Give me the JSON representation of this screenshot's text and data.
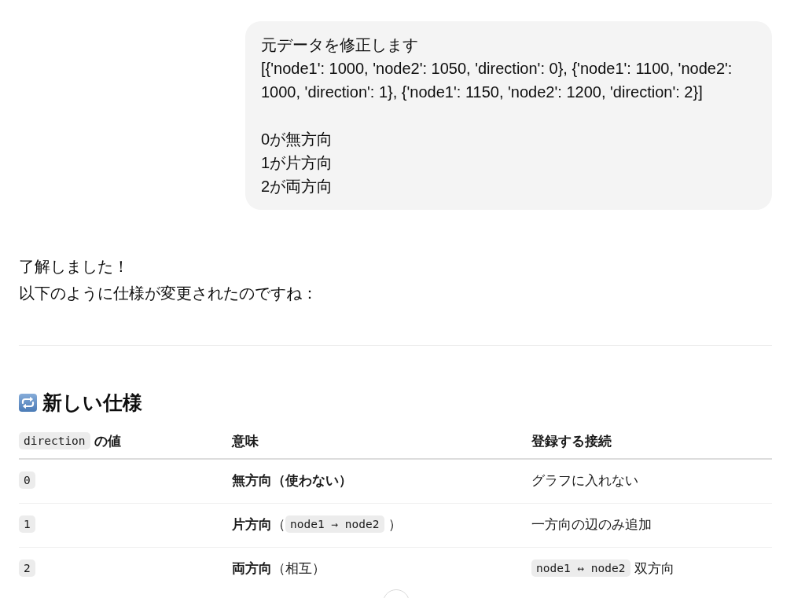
{
  "user_message": {
    "paragraphs": [
      {
        "lines": [
          "元データを修正します",
          "[{'node1': 1000, 'node2': 1050, 'direction': 0}, {'node1': 1100, 'node2': 1000, 'direction': 1}, {'node1': 1150, 'node2': 1200, 'direction': 2}]"
        ]
      },
      {
        "lines": [
          "0が無方向",
          "1が片方向",
          "2が両方向"
        ]
      }
    ]
  },
  "assistant_message": {
    "lines": [
      "了解しました！",
      "以下のように仕様が変更されたのですね："
    ],
    "section": {
      "heading": "新しい仕様",
      "table": {
        "columns": [
          {
            "segments": [
              {
                "kind": "code",
                "text": "direction"
              },
              {
                "kind": "text",
                "text": "の値"
              }
            ]
          },
          {
            "segments": [
              {
                "kind": "text",
                "text": "意味"
              }
            ]
          },
          {
            "segments": [
              {
                "kind": "text",
                "text": "登録する接続"
              }
            ]
          }
        ],
        "rows": [
          {
            "cells": [
              {
                "segments": [
                  {
                    "kind": "code",
                    "text": "0"
                  }
                ]
              },
              {
                "segments": [
                  {
                    "kind": "strong",
                    "text": "無方向（使わない）"
                  }
                ]
              },
              {
                "segments": [
                  {
                    "kind": "text",
                    "text": "グラフに入れない"
                  }
                ]
              }
            ]
          },
          {
            "cells": [
              {
                "segments": [
                  {
                    "kind": "code",
                    "text": "1"
                  }
                ]
              },
              {
                "segments": [
                  {
                    "kind": "text",
                    "text": "**片方向**（"
                  },
                  {
                    "kind": "code",
                    "text": "node1 → node2"
                  },
                  {
                    "kind": "text",
                    "text": "）"
                  }
                ]
              },
              {
                "segments": [
                  {
                    "kind": "text",
                    "text": "一方向の辺のみ追加"
                  }
                ]
              }
            ]
          },
          {
            "cells": [
              {
                "segments": [
                  {
                    "kind": "code",
                    "text": "2"
                  }
                ]
              },
              {
                "segments": [
                  {
                    "kind": "text",
                    "text": "**両方向**（相互）"
                  }
                ]
              },
              {
                "segments": [
                  {
                    "kind": "code",
                    "text": "node1 ↔ node2"
                  },
                  {
                    "kind": "text",
                    "text": "双方向"
                  }
                ]
              }
            ]
          }
        ]
      }
    }
  }
}
